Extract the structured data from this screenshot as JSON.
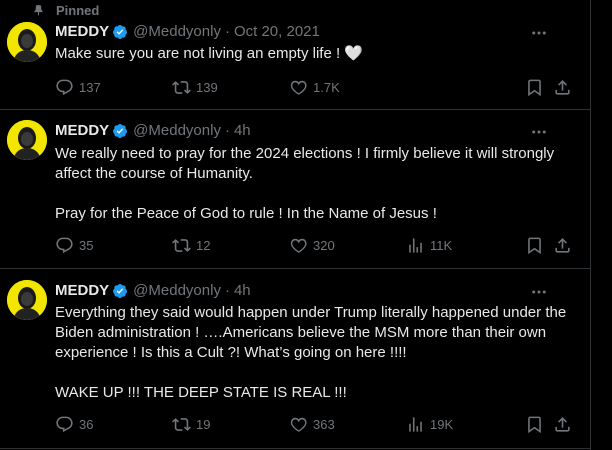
{
  "pinned_label": "Pinned",
  "tweets": [
    {
      "name": "MEDDY",
      "handle": "@Meddyonly",
      "time": "Oct 20, 2021",
      "text": "Make sure you are not living an empty life ! 🤍",
      "replies": "137",
      "retweets": "139",
      "likes": "1.7K",
      "views": ""
    },
    {
      "name": "MEDDY",
      "handle": "@Meddyonly",
      "time": "4h",
      "text": "We really need to pray for the 2024 elections ! I firmly believe it will strongly affect the course of Humanity.\n\nPray for the Peace of God to rule ! In the Name of Jesus !",
      "replies": "35",
      "retweets": "12",
      "likes": "320",
      "views": "11K"
    },
    {
      "name": "MEDDY",
      "handle": "@Meddyonly",
      "time": "4h",
      "text": "Everything they said would happen under Trump literally happened under the Biden administration  ! ….Americans believe the MSM more than their own experience ! Is this a Cult ?! What’s going on here !!!!\n\nWAKE UP !!!  THE DEEP STATE IS REAL !!!",
      "replies": "36",
      "retweets": "19",
      "likes": "363",
      "views": "19K"
    }
  ],
  "colors": {
    "background": "#000000",
    "text": "#e7e9ea",
    "muted": "#71767b",
    "verified": "#1d9bf0",
    "avatar": "#f2e600",
    "divider": "#2f3336"
  },
  "icons": [
    "pin-icon",
    "verified-badge-icon",
    "more-icon",
    "reply-icon",
    "retweet-icon",
    "like-icon",
    "views-icon",
    "bookmark-icon",
    "share-icon"
  ]
}
